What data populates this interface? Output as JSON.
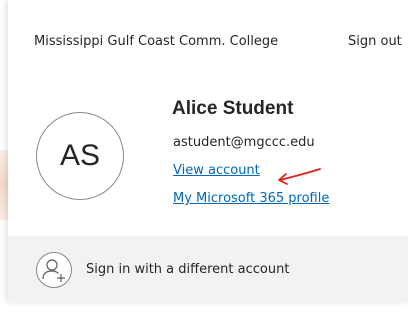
{
  "header": {
    "organization": "Mississippi Gulf Coast Comm. College",
    "sign_out_label": "Sign out"
  },
  "account": {
    "initials": "AS",
    "display_name": "Alice Student",
    "email": "astudent@mgccc.edu",
    "view_account_label": "View account",
    "profile_link_label": "My Microsoft 365 profile"
  },
  "footer": {
    "switch_account_label": "Sign in with a different account",
    "icon": "add-person-icon"
  },
  "colors": {
    "link": "#0067b8",
    "annotation": "#e0241b",
    "footer_background": "#f2f2f2"
  }
}
